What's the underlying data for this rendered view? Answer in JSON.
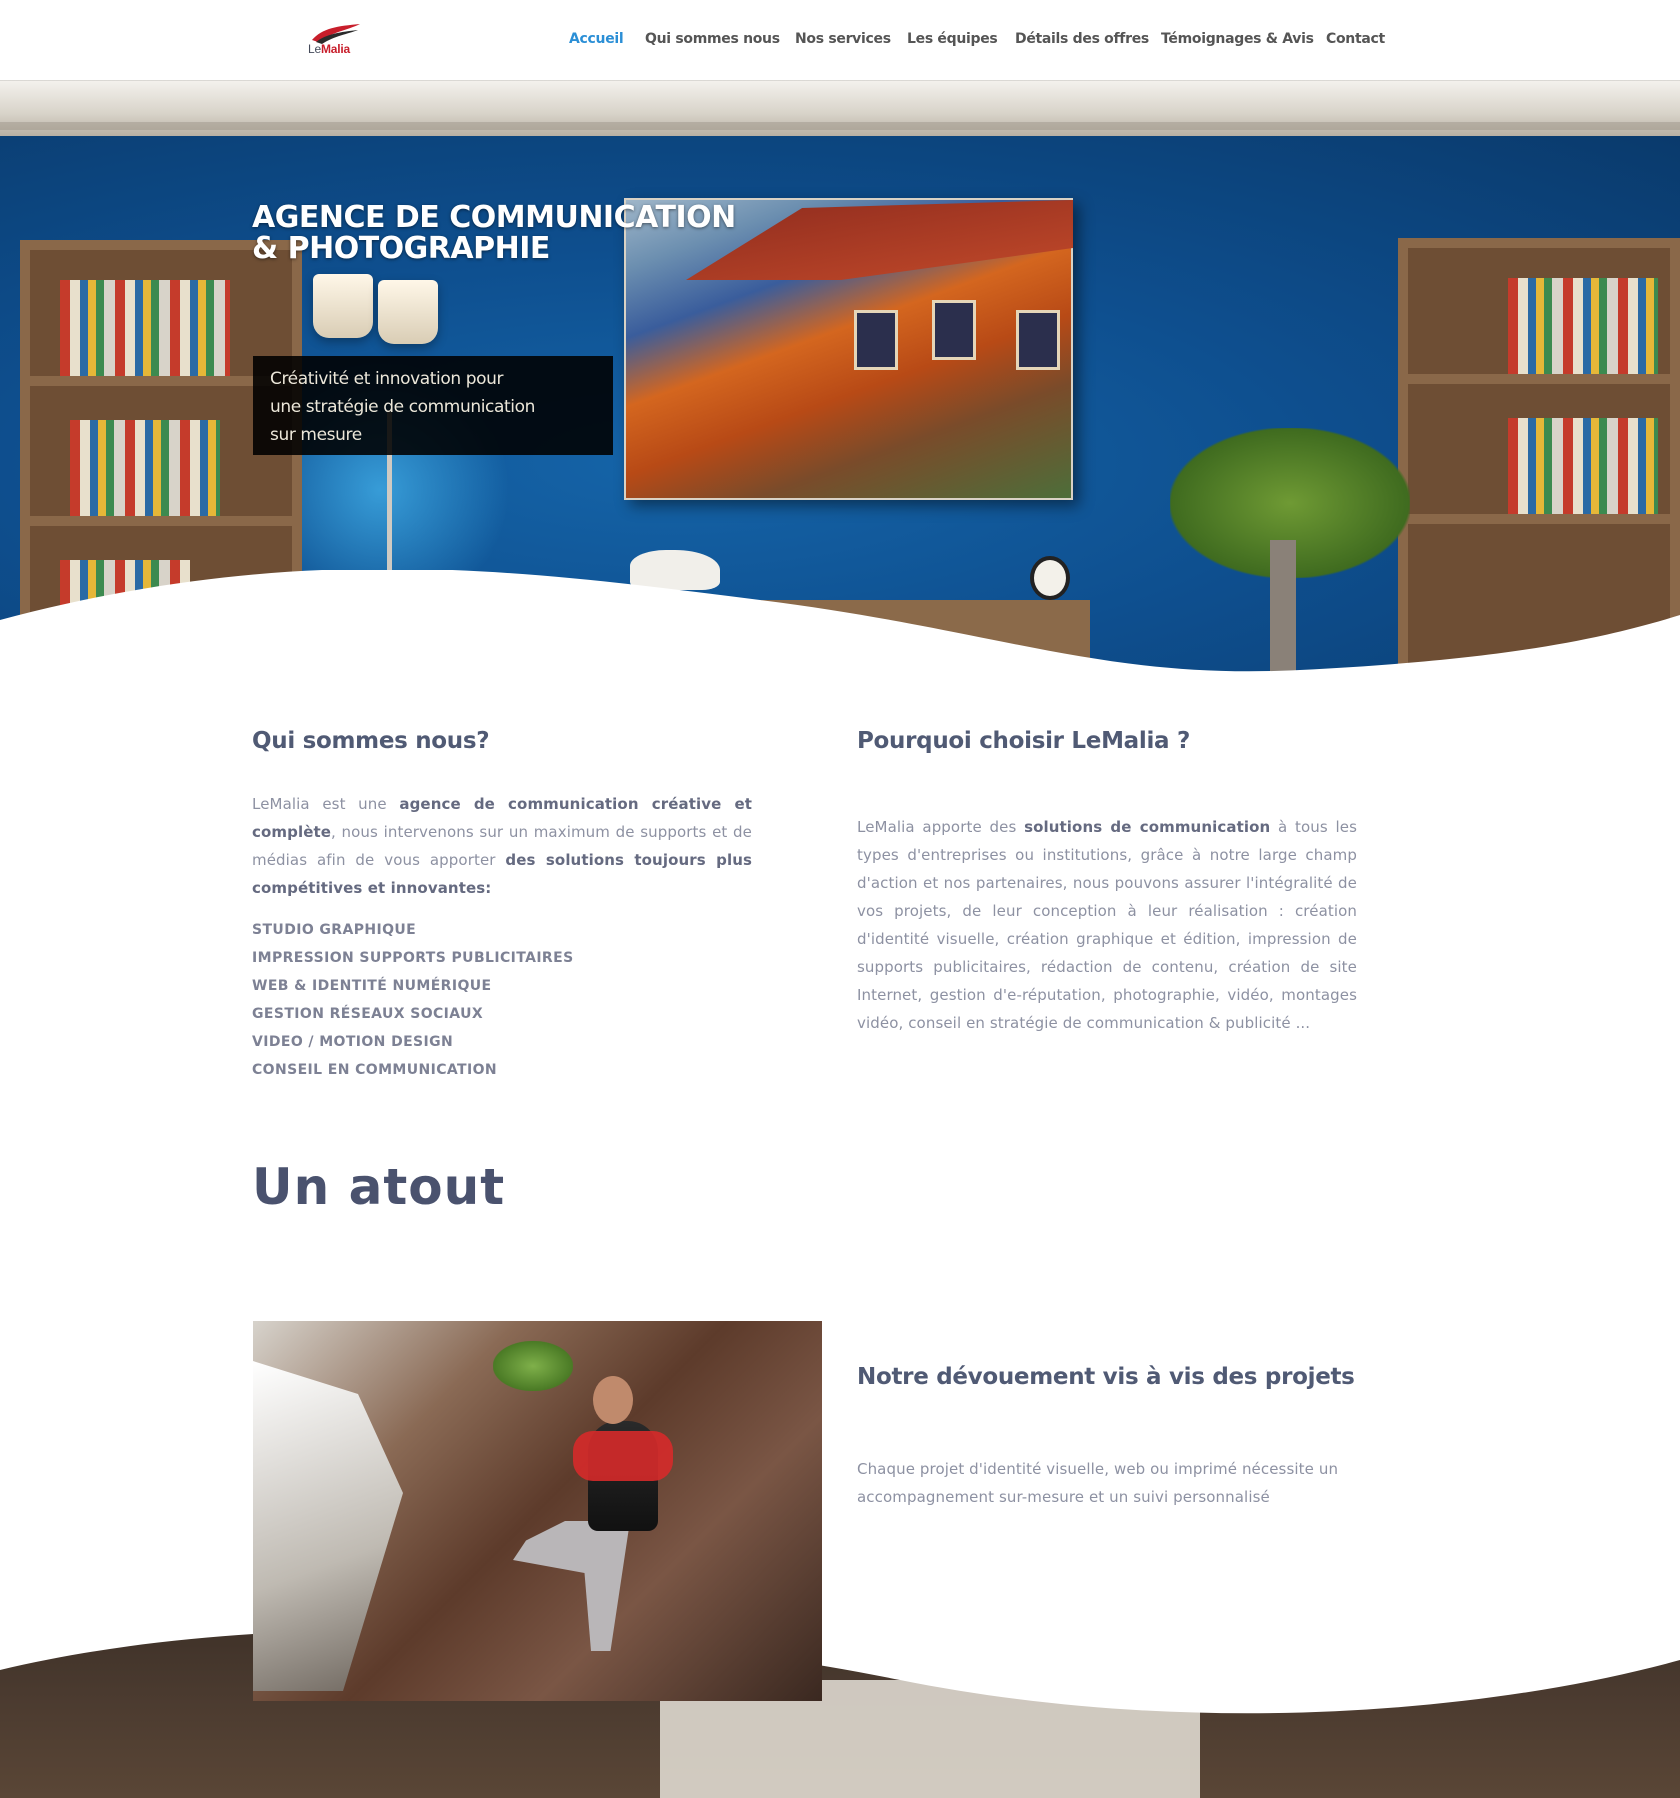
{
  "logo": {
    "part1": "Le",
    "part2": "Malia"
  },
  "nav": {
    "items": [
      {
        "label": "Accueil",
        "active": true
      },
      {
        "label": "Qui sommes nous",
        "active": false
      },
      {
        "label": "Nos services",
        "active": false
      },
      {
        "label": "Les équipes",
        "active": false
      },
      {
        "label": "Détails des offres",
        "active": false
      },
      {
        "label": "Témoignages & Avis",
        "active": false
      },
      {
        "label": "Contact",
        "active": false
      }
    ]
  },
  "hero": {
    "title_line1": "AGENCE DE COMMUNICATION",
    "title_line2": "& PHOTOGRAPHIE",
    "tagline_line1": "Créativité et innovation pour",
    "tagline_line2": "une stratégie de communication",
    "tagline_line3": "sur mesure"
  },
  "about": {
    "heading": "Qui sommes nous?",
    "p_1": "LeMalia est une ",
    "p_2": "agence de communication créative et complète",
    "p_3": ", nous intervenons sur un maximum de supports et de médias afin de vous apporter ",
    "p_4": "des solutions toujours plus compétitives et innovantes:",
    "services": [
      "STUDIO GRAPHIQUE",
      "IMPRESSION SUPPORTS PUBLICITAIRES",
      "WEB & IDENTITÉ NUMÉRIQUE",
      "GESTION RÉSEAUX SOCIAUX",
      "VIDEO / MOTION DESIGN",
      "CONSEIL EN COMMUNICATION"
    ]
  },
  "why": {
    "heading": "Pourquoi choisir LeMalia ?",
    "p_1": "LeMalia apporte des ",
    "p_2": "solutions de communication",
    "p_3": " à tous les types d'entreprises ou institutions, grâce à notre large champ d'action et nos partenaires, nous pouvons assurer l'intégralité de vos projets, de leur conception à leur réalisation : création d'identité visuelle, création graphique et édition, impression de supports publicitaires, rédaction de contenu, création de site Internet, gestion d'e-réputation, photographie, vidéo, montages vidéo, conseil en stratégie de communication & publicité ..."
  },
  "atout": {
    "heading": "Un atout"
  },
  "devouement": {
    "heading": "Notre dévouement vis à vis des projets",
    "text": "Chaque projet d'identité visuelle, web ou imprimé nécessite un accompagnement sur-mesure et un suivi personnalisé"
  },
  "colors": {
    "accent": "#2b8fd6",
    "heading": "#505a74",
    "text": "#8d91a2",
    "logo_red": "#c81e2b"
  }
}
